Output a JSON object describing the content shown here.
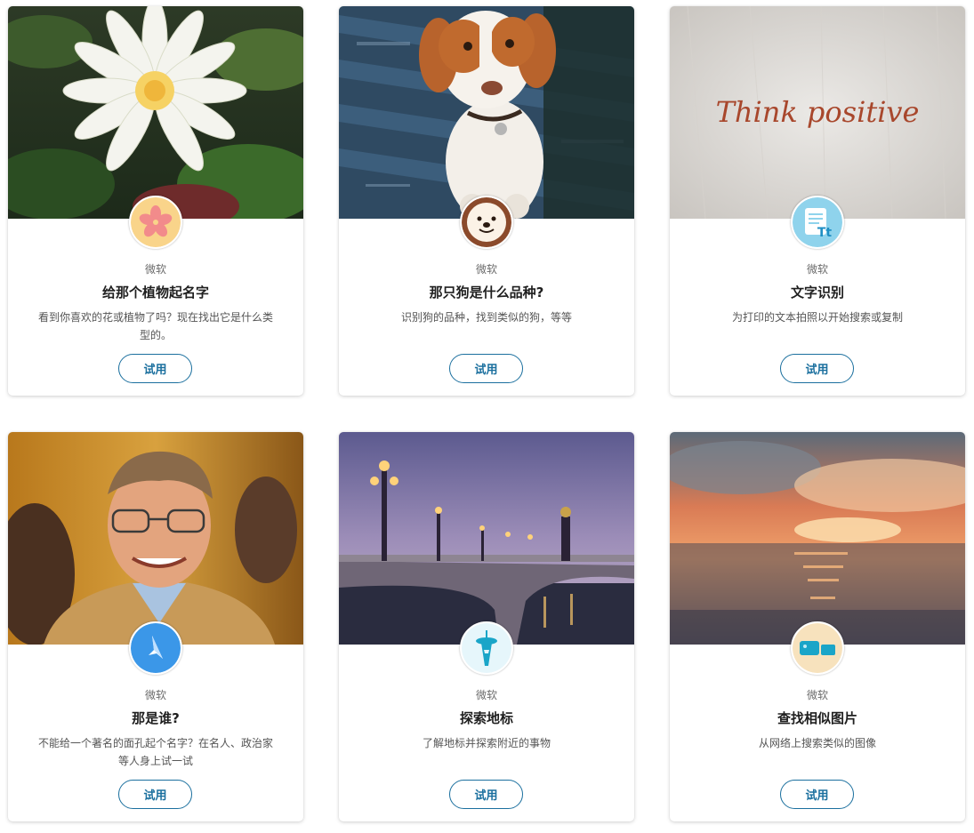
{
  "cards": [
    {
      "publisher": "微软",
      "title": "给那个植物起名字",
      "description": "看到你喜欢的花或植物了吗？现在找出它是什么类型的。",
      "button": "试用",
      "image_icon": "flower-icon",
      "badge_color": "#f9d48a"
    },
    {
      "publisher": "微软",
      "title": "那只狗是什么品种?",
      "description": "识别狗的品种，找到类似的狗，等等",
      "button": "试用",
      "image_icon": "dog-face-icon",
      "badge_color": "#8b4a2b"
    },
    {
      "publisher": "微软",
      "title": "文字识别",
      "description": "为打印的文本拍照以开始搜索或复制",
      "button": "试用",
      "image_icon": "text-document-icon",
      "badge_color": "#8fd3ec",
      "hero_text": "Think positive"
    },
    {
      "publisher": "微软",
      "title": "那是谁?",
      "description": "不能给一个著名的面孔起个名字？在名人、政治家等人身上试一试",
      "button": "试用",
      "image_icon": "star-pointer-icon",
      "badge_color": "#3b97e8"
    },
    {
      "publisher": "微软",
      "title": "探索地标",
      "description": "了解地标并探索附近的事物",
      "button": "试用",
      "image_icon": "space-needle-icon",
      "badge_color": "#e6f6fb"
    },
    {
      "publisher": "微软",
      "title": "查找相似图片",
      "description": "从网络上搜索类似的图像",
      "button": "试用",
      "image_icon": "similar-images-icon",
      "badge_color": "#f7e2bd"
    }
  ]
}
